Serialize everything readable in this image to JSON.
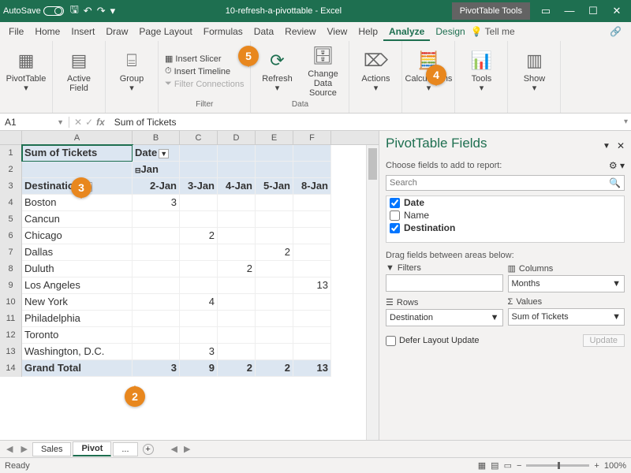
{
  "titlebar": {
    "autosave": "AutoSave",
    "docname": "10-refresh-a-pivottable  -  Excel",
    "contextual": "PivotTable Tools"
  },
  "menu": {
    "file": "File",
    "home": "Home",
    "insert": "Insert",
    "draw": "Draw",
    "pagelayout": "Page Layout",
    "formulas": "Formulas",
    "data": "Data",
    "review": "Review",
    "view": "View",
    "help": "Help",
    "analyze": "Analyze",
    "design": "Design",
    "tellme": "Tell me"
  },
  "ribbon": {
    "pivottable": "PivotTable",
    "activefield": "Active\nField",
    "group": "Group",
    "slicer": "Insert Slicer",
    "timeline": "Insert Timeline",
    "filterconn": "Filter Connections",
    "refresh": "Refresh",
    "changedata": "Change Data\nSource",
    "actions": "Actions",
    "calc": "Calculations",
    "tools": "Tools",
    "show": "Show",
    "g_filter": "Filter",
    "g_data": "Data"
  },
  "formulabar": {
    "cellref": "A1",
    "formula": "Sum of Tickets"
  },
  "colheaders": [
    "A",
    "B",
    "C",
    "D",
    "E",
    "F"
  ],
  "pivot": {
    "a1": "Sum of Tickets",
    "b1": "Date",
    "b2": "Jan",
    "a3": "Destination",
    "b3": "2-Jan",
    "c3": "3-Jan",
    "d3": "4-Jan",
    "e3": "5-Jan",
    "f3": "8-Jan",
    "rows": [
      {
        "n": "4",
        "dest": "Boston",
        "b": "3",
        "c": "",
        "d": "",
        "e": "",
        "f": ""
      },
      {
        "n": "5",
        "dest": "Cancun",
        "b": "",
        "c": "",
        "d": "",
        "e": "",
        "f": ""
      },
      {
        "n": "6",
        "dest": "Chicago",
        "b": "",
        "c": "2",
        "d": "",
        "e": "",
        "f": ""
      },
      {
        "n": "7",
        "dest": "Dallas",
        "b": "",
        "c": "",
        "d": "",
        "e": "2",
        "f": ""
      },
      {
        "n": "8",
        "dest": "Duluth",
        "b": "",
        "c": "",
        "d": "2",
        "e": "",
        "f": ""
      },
      {
        "n": "9",
        "dest": "Los Angeles",
        "b": "",
        "c": "",
        "d": "",
        "e": "",
        "f": "13"
      },
      {
        "n": "10",
        "dest": "New York",
        "b": "",
        "c": "4",
        "d": "",
        "e": "",
        "f": ""
      },
      {
        "n": "11",
        "dest": "Philadelphia",
        "b": "",
        "c": "",
        "d": "",
        "e": "",
        "f": ""
      },
      {
        "n": "12",
        "dest": "Toronto",
        "b": "",
        "c": "",
        "d": "",
        "e": "",
        "f": ""
      },
      {
        "n": "13",
        "dest": "Washington, D.C.",
        "b": "",
        "c": "3",
        "d": "",
        "e": "",
        "f": ""
      }
    ],
    "total": {
      "label": "Grand Total",
      "b": "3",
      "c": "9",
      "d": "2",
      "e": "2",
      "f": "13"
    }
  },
  "pane": {
    "title": "PivotTable Fields",
    "choose": "Choose fields to add to report:",
    "search": "Search",
    "fields": [
      {
        "label": "Date",
        "checked": true
      },
      {
        "label": "Name",
        "checked": false
      },
      {
        "label": "Destination",
        "checked": true
      }
    ],
    "dragtxt": "Drag fields between areas below:",
    "filters": "Filters",
    "columns": "Columns",
    "rowslbl": "Rows",
    "values": "Values",
    "col_val": "Months",
    "row_val": "Destination",
    "val_val": "Sum of Tickets",
    "defer": "Defer Layout Update",
    "update": "Update"
  },
  "tabs": {
    "sales": "Sales",
    "pivot": "Pivot",
    "dots": "..."
  },
  "status": {
    "ready": "Ready",
    "zoom": "100%"
  },
  "callouts": {
    "c2": "2",
    "c3": "3",
    "c4": "4",
    "c5": "5"
  }
}
